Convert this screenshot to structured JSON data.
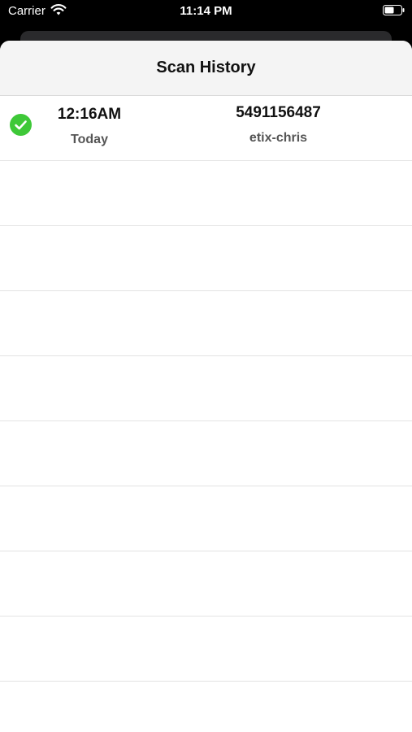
{
  "status_bar": {
    "carrier": "Carrier",
    "time": "11:14 PM",
    "wifi_icon": "wifi-icon",
    "battery_icon": "battery-icon"
  },
  "header": {
    "title": "Scan History"
  },
  "scans": [
    {
      "status_icon": "checkmark-circle-icon",
      "status_color": "#3ec838",
      "time": "12:16AM",
      "date": "Today",
      "code": "5491156487",
      "user": "etix-chris"
    }
  ],
  "colors": {
    "accent_success": "#3ec838",
    "header_bg": "#f4f4f4",
    "separator": "#e3e3e3"
  }
}
